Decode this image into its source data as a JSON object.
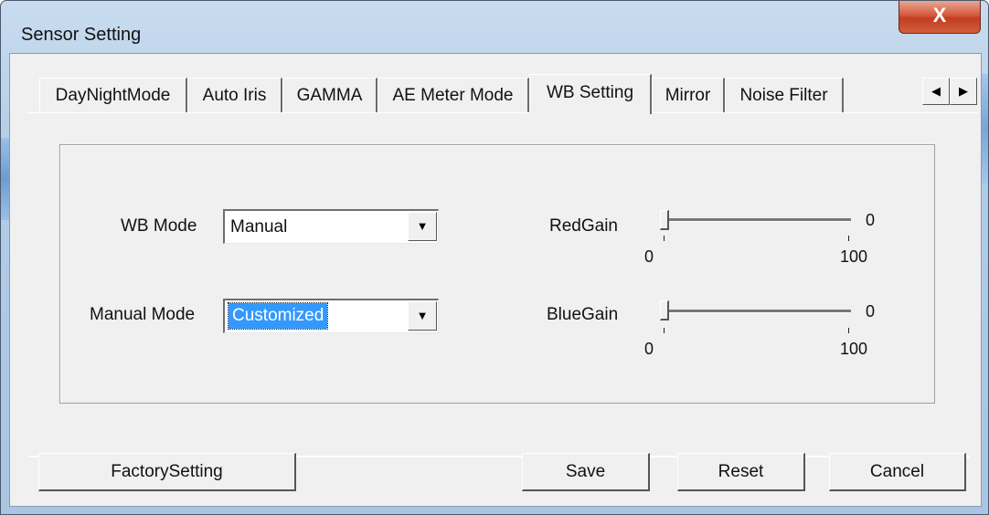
{
  "window": {
    "title": "Sensor Setting",
    "close_glyph": "X"
  },
  "tabs": [
    {
      "label": "DayNightMode",
      "active": false
    },
    {
      "label": "Auto Iris",
      "active": false
    },
    {
      "label": "GAMMA",
      "active": false
    },
    {
      "label": "AE Meter Mode",
      "active": false
    },
    {
      "label": "WB Setting",
      "active": true
    },
    {
      "label": "Mirror",
      "active": false
    },
    {
      "label": "Noise Filter",
      "active": false
    }
  ],
  "tab_scroll": {
    "left_icon": "triangle-left-icon",
    "right_icon": "triangle-right-icon",
    "left_glyph": "◀",
    "right_glyph": "▶"
  },
  "wb": {
    "mode_label": "WB Mode",
    "mode_value": "Manual",
    "manual_mode_label": "Manual Mode",
    "manual_mode_value": "Customized",
    "dropdown_glyph": "▼"
  },
  "red_gain": {
    "label": "RedGain",
    "value": "0",
    "min": "0",
    "max": "100",
    "level": 0
  },
  "blue_gain": {
    "label": "BlueGain",
    "value": "0",
    "min": "0",
    "max": "100",
    "level": 0
  },
  "buttons": {
    "factory": "FactorySetting",
    "save": "Save",
    "reset": "Reset",
    "cancel": "Cancel"
  },
  "colors": {
    "selection": "#3399ff",
    "close_button": "#c9452a",
    "frame": "#b3cde6"
  }
}
